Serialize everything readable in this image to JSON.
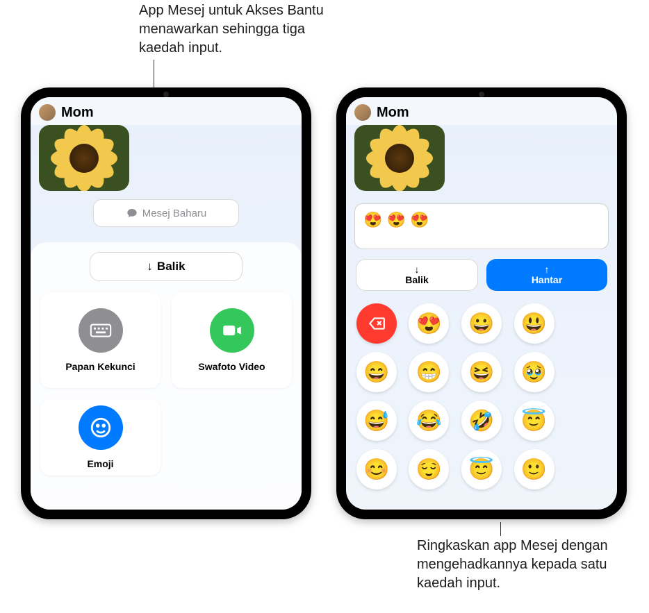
{
  "callouts": {
    "top": "App Mesej untuk Akses Bantu menawarkan sehingga tiga kaedah input.",
    "bottom": "Ringkaskan app Mesej dengan mengehadkannya kepada satu kaedah input."
  },
  "left": {
    "contact": "Mom",
    "new_message": "Mesej Baharu",
    "back_label": "Balik",
    "tiles": {
      "keyboard": "Papan Kekunci",
      "video_selfie": "Swafoto Video",
      "emoji": "Emoji"
    }
  },
  "right": {
    "contact": "Mom",
    "compose_value": "😍 😍 😍",
    "back_label": "Balik",
    "send_label": "Hantar",
    "delete_icon": "delete-left-icon",
    "emoji_keys": [
      "😍",
      "😀",
      "😃",
      "😄",
      "😁",
      "😆",
      "🥹",
      "😅",
      "😂",
      "🤣",
      "😇",
      "😊",
      "😌",
      "😇",
      "🙂"
    ]
  }
}
